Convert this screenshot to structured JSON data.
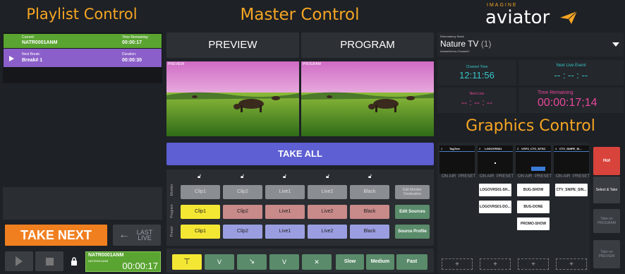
{
  "headers": {
    "playlist": "Playlist Control",
    "master": "Master Control",
    "graphics": "Graphics Control",
    "brand_small": "IMAGINE",
    "brand": "aviator"
  },
  "playlist": {
    "current_label": "Current:",
    "current_value": "NATR0001ANM",
    "time_remaining_label": "Time Remaining:",
    "time_remaining_value": "00:00:17",
    "next_break_label": "Next Break:",
    "next_break_value": "Break# 1",
    "duration_label": "Duration:",
    "duration_value": "00:00:30",
    "take_next": "TAKE NEXT",
    "last_live": "LAST LIVE",
    "status_clip": "NATR0001ANM",
    "status_sub": "NATR0001ANM",
    "status_time": "00:00:17"
  },
  "master": {
    "preview_tab": "PREVIEW",
    "program_tab": "PROGRAM",
    "preview_small": "PREVIEW",
    "program_small": "PROGRAM",
    "take_all": "TAKE ALL",
    "row_labels": [
      "Monitor",
      "Program",
      "Preset"
    ],
    "monitor_row": [
      "Clip1",
      "Clip2",
      "Live1",
      "Live2",
      "Black"
    ],
    "program_row": [
      "Clip1",
      "Clip2",
      "Live1",
      "Live2",
      "Black"
    ],
    "preset_row": [
      "Clip1",
      "Clip2",
      "Live1",
      "Live2",
      "Black"
    ],
    "side_buttons": [
      "Edit Monitor Destination",
      "Edit Sources",
      "Source Profile"
    ],
    "transitions": [
      "⊤",
      "V",
      "↘",
      "V",
      "✕"
    ],
    "speeds": [
      "Slow",
      "Medium",
      "Fast"
    ]
  },
  "status": {
    "redundancy_label": "Redundancy Stack",
    "channel_name": "Nature TV",
    "channel_count": "(1)",
    "channel_sub": "AviatorDemo-Channel1",
    "channel_time_label": "Channel Time",
    "channel_time": "12:11:56",
    "next_live_label": "Next Live Event",
    "next_live": "-- : -- : --",
    "next_live_left_label": "Next Live",
    "next_live_left": "-- : -- : --",
    "time_remaining_label": "Time Remaining",
    "time_remaining": "00:00:17;14"
  },
  "graphics": {
    "columns": [
      {
        "num": "1",
        "name": "TagText"
      },
      {
        "num": "2",
        "name": "LOGOVRS01"
      },
      {
        "num": "3",
        "name": "VGFX_CTC_NTSC"
      },
      {
        "num": "4",
        "name": "CTV_SNIPE_SI..."
      }
    ],
    "on_air": "ON AIR",
    "preset": "PRESET",
    "cells": {
      "c2a": "LOGOVRS01-SH...",
      "c2b": "LOGOVRS01-DO...",
      "c3a": "BUG-SHOW",
      "c3b": "BUG-DONE",
      "c3c": "PROMO-SHOW",
      "c4a": "CTV_SNIPE_SIN..."
    },
    "hot": "Hot",
    "select_take": "Select & Take",
    "take_program": "Take on PROGRAM",
    "take_preview": "Take on PREVIEW",
    "plus": "+"
  },
  "colors": {
    "accent": "#f6a623",
    "current_bar": "#5aa431",
    "next_bar": "#8b5fc9",
    "take_all": "#5d5fd2",
    "hot": "#d8433b",
    "teal_text": "#35c7c7",
    "pink_text": "#e8479b"
  }
}
